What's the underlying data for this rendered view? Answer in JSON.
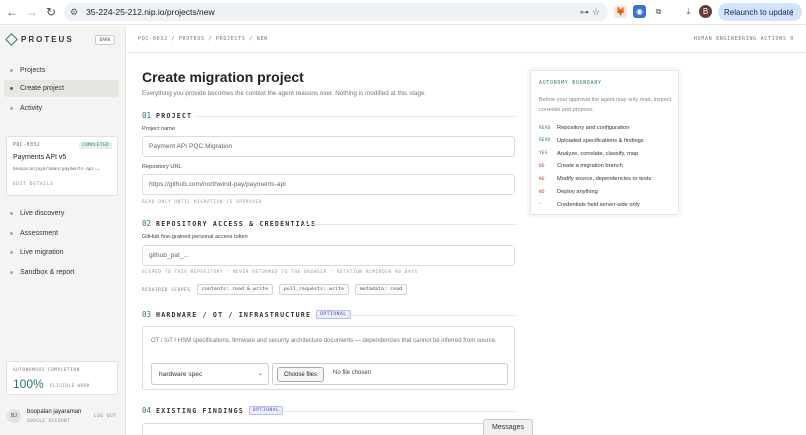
{
  "browser": {
    "url": "35-224-25-212.nip.io/projects/new",
    "relaunch_label": "Relaunch to update",
    "profile_initial": "B"
  },
  "sidebar": {
    "brand": "PROTEUS",
    "dark_toggle": "DARK",
    "nav_top": [
      {
        "label": "Projects",
        "active": false
      },
      {
        "label": "Create project",
        "active": true
      },
      {
        "label": "Activity",
        "active": false
      }
    ],
    "project_card": {
      "id": "PQC-0032",
      "status": "COMPLETED",
      "name": "Payments API v5",
      "user": "boopalanjayaraman/payments-api-…",
      "edit": "EDIT DETAILS"
    },
    "nav_bottom": [
      {
        "label": "Live discovery"
      },
      {
        "label": "Assessment"
      },
      {
        "label": "Live migration"
      },
      {
        "label": "Sandbox & report"
      }
    ],
    "completion": {
      "title": "AUTONOMOUS COMPLETION",
      "value": "100%",
      "sub": "ELIGIBLE WORK"
    },
    "user": {
      "initials": "BJ",
      "name": "boopalan jayaraman",
      "account": "GOOGLE ACCOUNT",
      "logout": "LOG OUT"
    }
  },
  "topbar": {
    "breadcrumb": "PQC-0032 / PROTEUS / PROJECTS / NEW",
    "right": "HUMAN ENGINEERING ACTIONS 0"
  },
  "page": {
    "title": "Create migration project",
    "subtitle": "Everything you provide becomes the context the agent reasons over. Nothing is modified at this stage."
  },
  "sections": {
    "project": {
      "num": "01",
      "title": "PROJECT",
      "name_label": "Project name",
      "name_placeholder": "Payment API PQC Migration",
      "repo_label": "Repository URL",
      "repo_placeholder": "https://github.com/northwind-pay/payments-api",
      "hint": "READ-ONLY UNTIL MIGRATION IS APPROVED"
    },
    "repo": {
      "num": "02",
      "title": "REPOSITORY ACCESS & CREDENTIALS",
      "token_label": "GitHub fine-grained personal access token",
      "token_placeholder": "github_pat_...",
      "hint": "SCOPED TO THIS REPOSITORY · NEVER RETURNED TO THE BROWSER · ROTATION REMINDER 90 DAYS",
      "scopes_label": "REQUIRED SCOPES",
      "scopes": [
        "contents: read & write",
        "pull_requests: write",
        "metadata: read"
      ]
    },
    "hardware": {
      "num": "03",
      "title": "HARDWARE / OT / INFRASTRUCTURE",
      "optional": "OPTIONAL",
      "desc": "OT / IoT / HSM specifications, firmware and security architecture documents — dependencies that cannot be inferred from source.",
      "select_value": "hardware spec",
      "file_button": "Choose files",
      "file_status": "No file chosen"
    },
    "findings": {
      "num": "04",
      "title": "EXISTING FINDINGS",
      "optional": "OPTIONAL"
    }
  },
  "autonomy": {
    "title": "AUTONOMY BOUNDARY",
    "desc": "Before your approval the agent may only read, inspect, correlate and propose.",
    "rows": [
      {
        "tag": "READ",
        "text": "Repository and configuration",
        "color": "#2d7a5b"
      },
      {
        "tag": "READ",
        "text": "Uploaded specifications & findings",
        "color": "#2d7a5b"
      },
      {
        "tag": "YES",
        "text": "Analyze, correlate, classify, map",
        "color": "#2d7a5b"
      },
      {
        "tag": "NO",
        "text": "Create a migration branch",
        "color": "#c0392b"
      },
      {
        "tag": "NO",
        "text": "Modify source, dependencies or tests",
        "color": "#c0392b"
      },
      {
        "tag": "NO",
        "text": "Deploy anything",
        "color": "#c0392b"
      },
      {
        "tag": "–",
        "text": "Credentials held server-side only",
        "color": "#666666"
      }
    ]
  },
  "messages_label": "Messages",
  "colors": {
    "accent": "#2d7a5b",
    "optional": "#3d4ab8"
  }
}
